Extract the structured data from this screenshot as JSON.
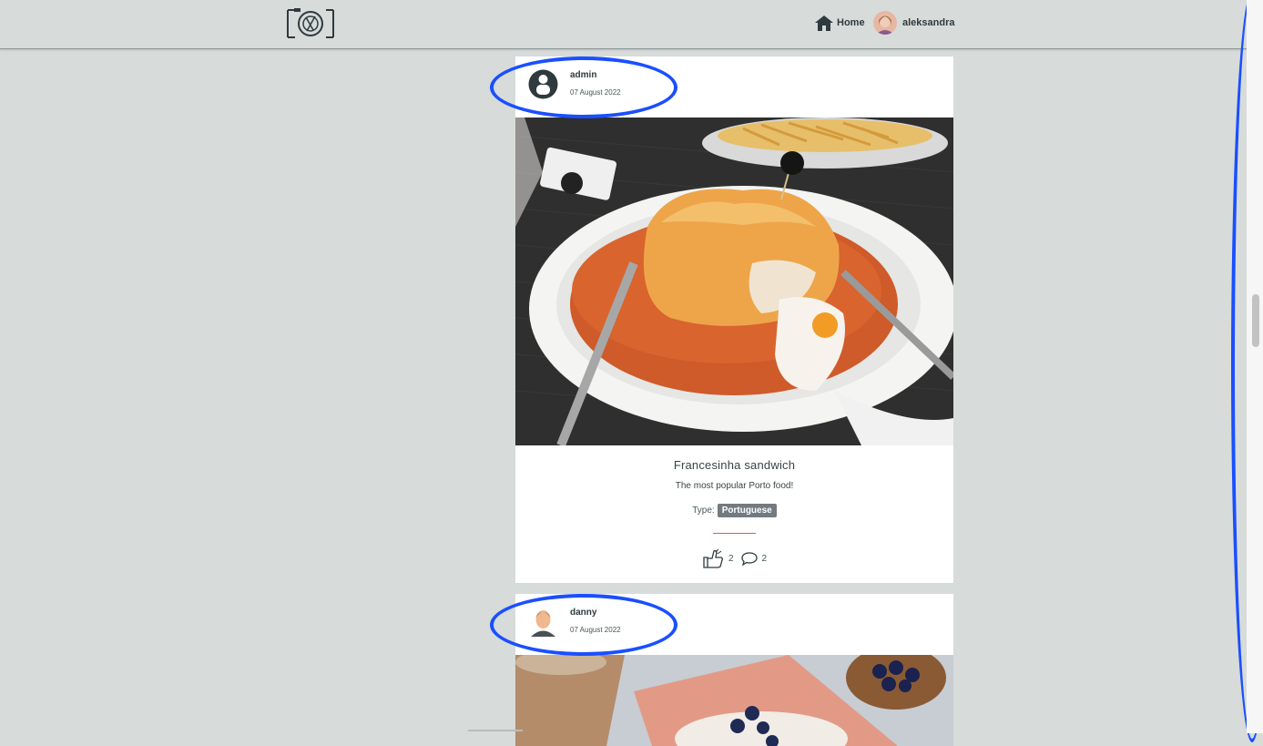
{
  "nav": {
    "logo_icon": "camera-plate-icon",
    "home_icon": "house-icon",
    "home_label": "Home",
    "user_label": "aleksandra"
  },
  "posts": [
    {
      "author": "admin",
      "date": "07 August 2022",
      "avatar_icon": "default-user-icon",
      "title": "Francesinha sandwich",
      "description": "The most popular Porto food!",
      "type_label": "Type:",
      "type_value": "Portuguese",
      "likes": "2",
      "comments": "2",
      "like_icon": "thumbs-up-icon",
      "comment_icon": "speech-bubble-icon"
    },
    {
      "author": "danny",
      "date": "07 August 2022",
      "avatar_icon": "man-avatar-icon"
    }
  ],
  "colors": {
    "page_bg": "#d7dbd9",
    "annotation": "#1a4fff",
    "badge": "#737a80",
    "divider": "#e05a4a"
  }
}
